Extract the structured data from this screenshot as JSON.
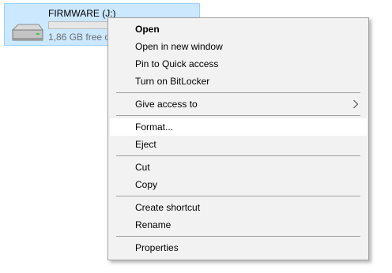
{
  "drive": {
    "name": "FIRMWARE (J:)",
    "free_text": "1,86 GB free of",
    "used_fraction": 0.0
  },
  "context_menu": {
    "groups": [
      [
        {
          "label": "Open",
          "bold": true
        },
        {
          "label": "Open in new window"
        },
        {
          "label": "Pin to Quick access"
        },
        {
          "label": "Turn on BitLocker"
        }
      ],
      [
        {
          "label": "Give access to",
          "submenu": true,
          "icon": "chevron-right-icon"
        }
      ],
      [
        {
          "label": "Format...",
          "highlighted": true
        },
        {
          "label": "Eject"
        }
      ],
      [
        {
          "label": "Cut"
        },
        {
          "label": "Copy"
        }
      ],
      [
        {
          "label": "Create shortcut"
        },
        {
          "label": "Rename"
        }
      ],
      [
        {
          "label": "Properties"
        }
      ]
    ]
  },
  "colors": {
    "selection_bg": "#cce8ff",
    "selection_border": "#99d1ff",
    "menu_bg": "#f2f2f2",
    "menu_border": "#a0a0a0",
    "highlight_bg": "#ffffff"
  }
}
